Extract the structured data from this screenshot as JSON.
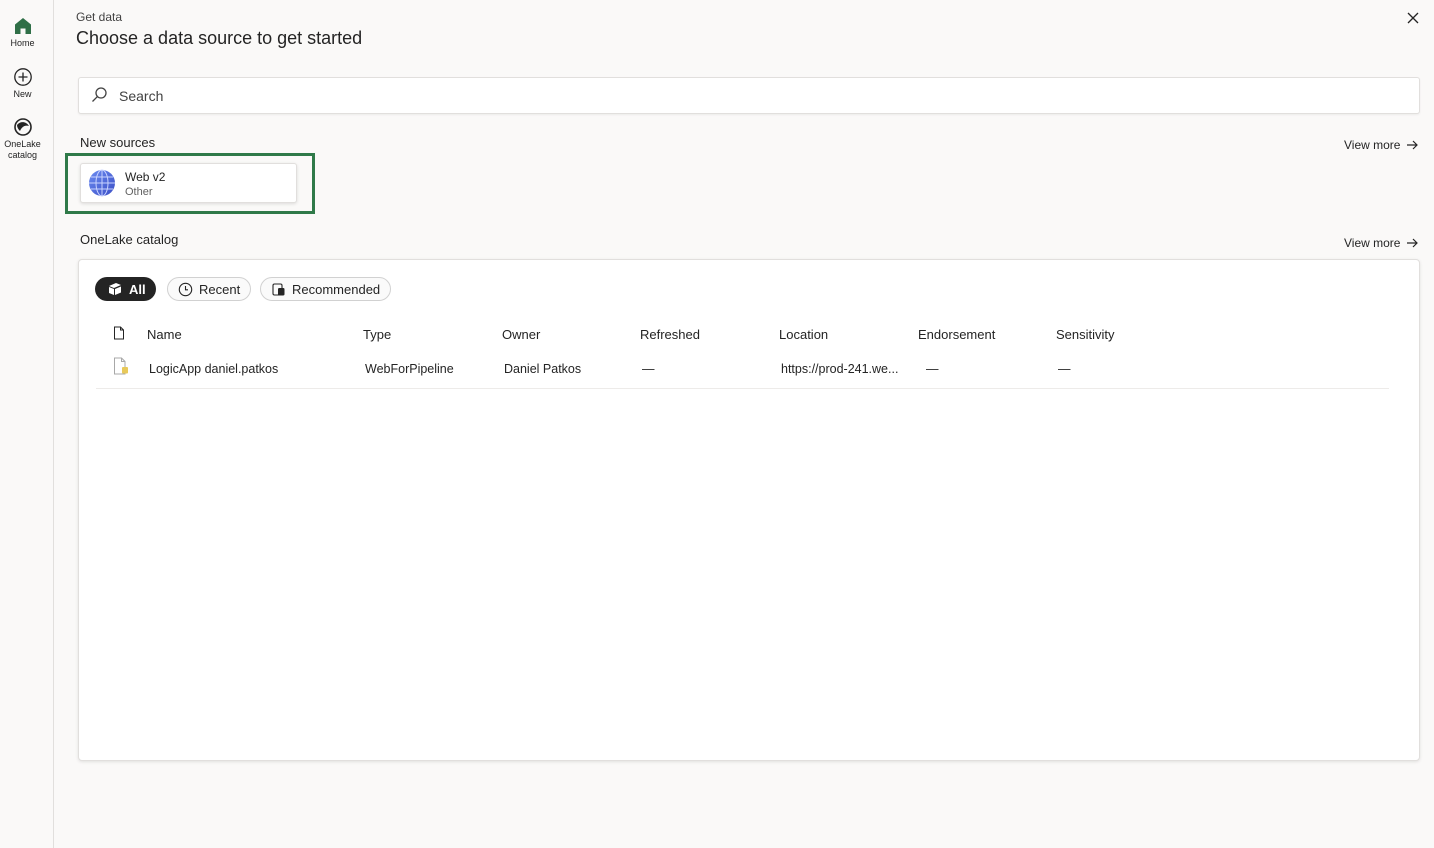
{
  "rail": {
    "items": [
      {
        "label": "Home"
      },
      {
        "label": "New"
      },
      {
        "label_line1": "OneLake",
        "label_line2": "catalog"
      }
    ]
  },
  "header": {
    "subtitle": "Get data",
    "title": "Choose a data source to get started"
  },
  "search": {
    "placeholder": "Search"
  },
  "new_sources": {
    "title": "New sources",
    "view_more": "View more",
    "items": [
      {
        "name": "Web v2",
        "category": "Other"
      }
    ]
  },
  "catalog": {
    "title": "OneLake catalog",
    "view_more": "View more",
    "filters": [
      {
        "label": "All",
        "selected": true
      },
      {
        "label": "Recent",
        "selected": false
      },
      {
        "label": "Recommended",
        "selected": false
      }
    ],
    "columns": [
      "Name",
      "Type",
      "Owner",
      "Refreshed",
      "Location",
      "Endorsement",
      "Sensitivity"
    ],
    "rows": [
      {
        "name": "LogicApp daniel.patkos",
        "type": "WebForPipeline",
        "owner": "Daniel Patkos",
        "refreshed": "—",
        "location": "https://prod-241.we...",
        "endorsement": "—",
        "sensitivity": "—"
      }
    ]
  },
  "colors": {
    "highlight": "#2f7a49",
    "home_icon": "#2f6f47",
    "pill_selected": "#242424"
  }
}
